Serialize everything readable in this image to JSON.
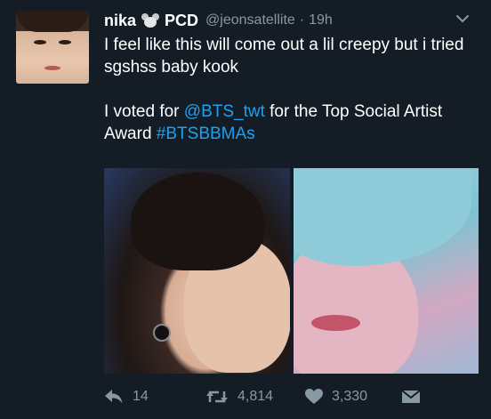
{
  "tweet": {
    "user": {
      "display_name": "nika",
      "badge_icon": "mouse-face-emoji-icon",
      "display_suffix": "PCD",
      "handle": "@jeonsatellite",
      "separator": "·",
      "time": "19h"
    },
    "text": {
      "line1": "I feel like this will come out a lil creepy but i tried sgshss baby kook",
      "vote_prefix": "I voted for ",
      "vote_mention": "@BTS_twt",
      "vote_middle": " for the Top Social Artist Award ",
      "vote_hashtag": "#BTSBBMAs"
    },
    "media": {
      "left_photo": "face-photo-left",
      "right_photo": "face-photo-right"
    },
    "actions": {
      "reply_icon": "reply-icon",
      "reply_count": "14",
      "retweet_icon": "retweet-icon",
      "retweet_count": "4,814",
      "like_icon": "heart-icon",
      "like_count": "3,330",
      "message_icon": "direct-message-icon"
    }
  },
  "colors": {
    "background": "#141d26",
    "text": "#ffffff",
    "muted": "#8899a6",
    "link": "#1da1f2"
  }
}
